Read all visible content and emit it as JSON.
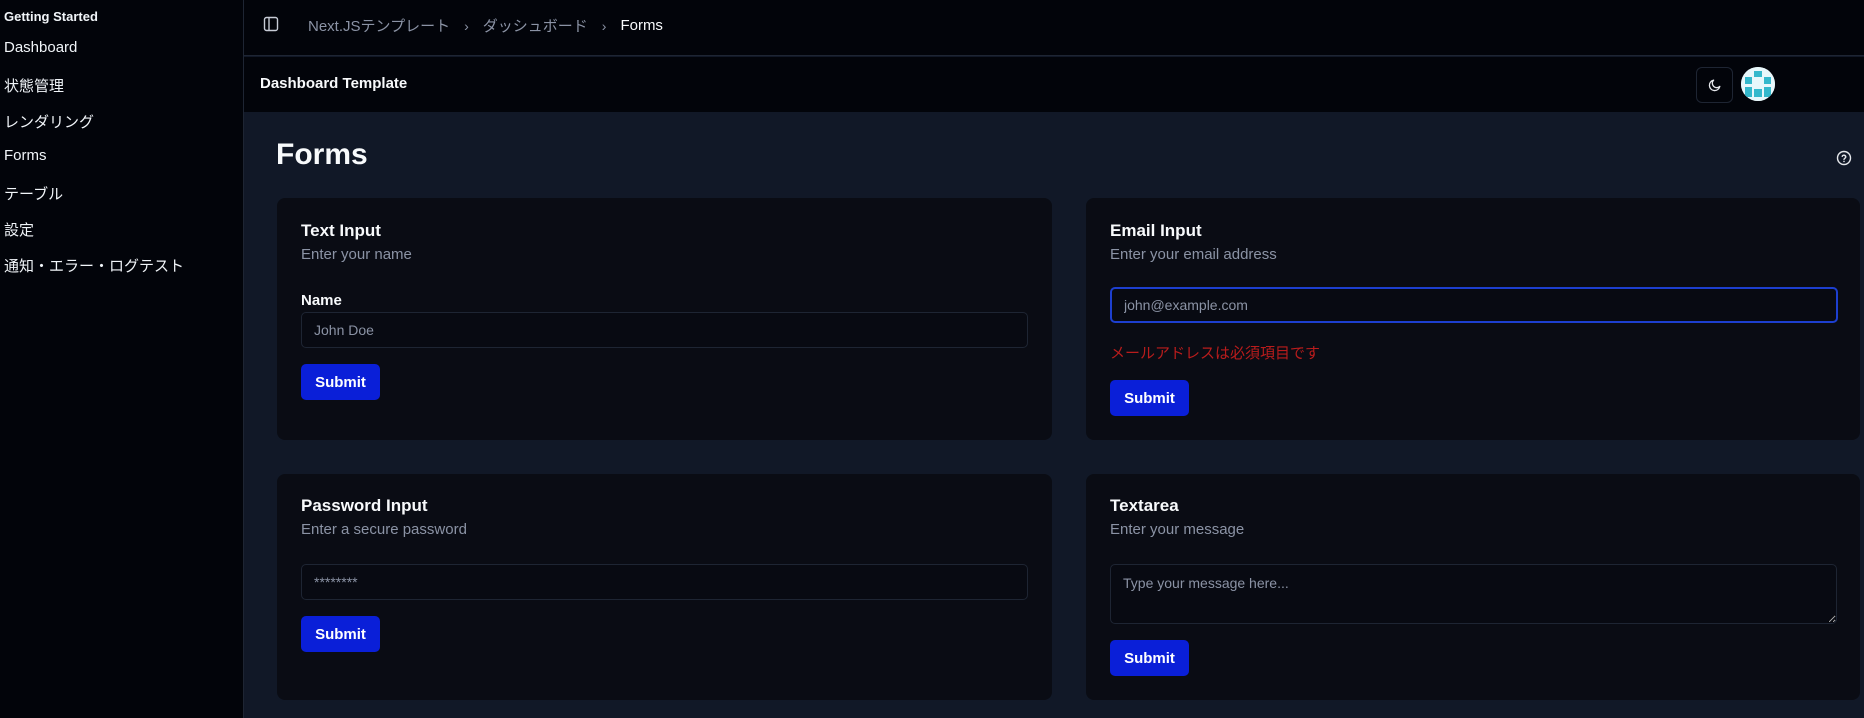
{
  "sidebar": {
    "group_label": "Getting Started",
    "items": [
      {
        "label": "Dashboard"
      },
      {
        "label": "状態管理"
      },
      {
        "label": "レンダリング"
      },
      {
        "label": "Forms"
      },
      {
        "label": "テーブル"
      },
      {
        "label": "設定"
      },
      {
        "label": "通知・エラー・ログテスト"
      }
    ]
  },
  "breadcrumb": {
    "items": [
      "Next.JSテンプレート",
      "ダッシュボード"
    ],
    "current": "Forms"
  },
  "header": {
    "title": "Dashboard Template",
    "theme_icon": "moon-icon"
  },
  "page": {
    "title": "Forms",
    "help_icon": "help-circle-icon"
  },
  "forms": {
    "text": {
      "title": "Text Input",
      "description": "Enter your name",
      "label": "Name",
      "placeholder": "John Doe",
      "submit": "Submit"
    },
    "email": {
      "title": "Email Input",
      "description": "Enter your email address",
      "placeholder": "john@example.com",
      "error": "メールアドレスは必須項目です",
      "submit": "Submit"
    },
    "password": {
      "title": "Password Input",
      "description": "Enter a secure password",
      "placeholder": "********",
      "submit": "Submit"
    },
    "textarea": {
      "title": "Textarea",
      "description": "Enter your message",
      "placeholder": "Type your message here...",
      "submit": "Submit"
    }
  },
  "colors": {
    "accent": "#0a1fd8",
    "error": "#b91c1c",
    "background": "#111827",
    "card": "#0a0c14",
    "sidebar": "#02040a"
  }
}
